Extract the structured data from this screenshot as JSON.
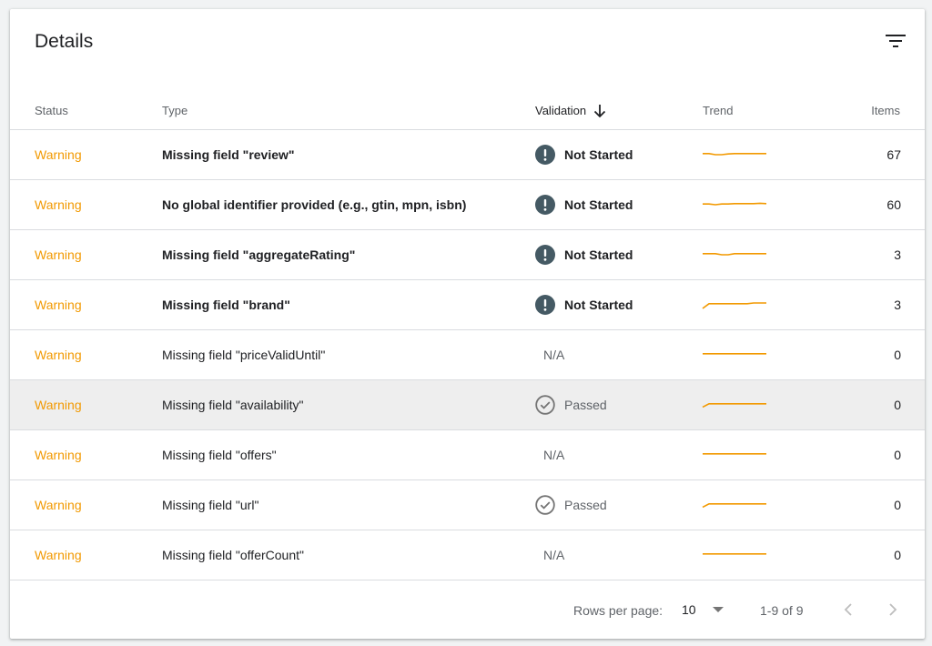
{
  "card": {
    "title": "Details",
    "filter_icon": "filter-list-icon"
  },
  "columns": {
    "status": "Status",
    "type": "Type",
    "validation": "Validation",
    "trend": "Trend",
    "items": "Items",
    "sort_icon": "arrow-down-icon"
  },
  "colors": {
    "warning": "#f29900",
    "trend_line": "#f29900",
    "not_started_icon": "#455a64",
    "passed_icon": "#757575",
    "highlight_row": "#eeeeee"
  },
  "rows": [
    {
      "status": "Warning",
      "type": "Missing field \"review\"",
      "bold": true,
      "validation": "Not Started",
      "validation_kind": "not_started",
      "items": "67",
      "trend": [
        0.3,
        0.3,
        0.0,
        0.0,
        0.2,
        0.3,
        0.3,
        0.3,
        0.3,
        0.3,
        0.3
      ]
    },
    {
      "status": "Warning",
      "type": "No global identifier provided (e.g., gtin, mpn, isbn)",
      "bold": true,
      "validation": "Not Started",
      "validation_kind": "not_started",
      "items": "60",
      "trend": [
        0.2,
        0.2,
        0.0,
        0.2,
        0.2,
        0.3,
        0.3,
        0.3,
        0.3,
        0.4,
        0.3
      ]
    },
    {
      "status": "Warning",
      "type": "Missing field \"aggregateRating\"",
      "bold": true,
      "validation": "Not Started",
      "validation_kind": "not_started",
      "items": "3",
      "trend": [
        0.3,
        0.3,
        0.3,
        0.0,
        0.0,
        0.3,
        0.3,
        0.3,
        0.3,
        0.3,
        0.3
      ]
    },
    {
      "status": "Warning",
      "type": "Missing field \"brand\"",
      "bold": true,
      "validation": "Not Started",
      "validation_kind": "not_started",
      "items": "3",
      "trend": [
        -1.0,
        0.3,
        0.3,
        0.3,
        0.3,
        0.3,
        0.3,
        0.3,
        0.5,
        0.5,
        0.5
      ]
    },
    {
      "status": "Warning",
      "type": "Missing field \"priceValidUntil\"",
      "bold": false,
      "validation": "N/A",
      "validation_kind": "na",
      "items": "0",
      "trend": [
        0.3,
        0.3,
        0.3,
        0.3,
        0.3,
        0.3,
        0.3,
        0.3,
        0.3,
        0.3,
        0.3
      ]
    },
    {
      "status": "Warning",
      "type": "Missing field \"availability\"",
      "bold": false,
      "validation": "Passed",
      "validation_kind": "passed",
      "items": "0",
      "trend": [
        -0.6,
        0.3,
        0.3,
        0.3,
        0.3,
        0.3,
        0.3,
        0.3,
        0.3,
        0.3,
        0.3
      ],
      "highlighted": true
    },
    {
      "status": "Warning",
      "type": "Missing field \"offers\"",
      "bold": false,
      "validation": "N/A",
      "validation_kind": "na",
      "items": "0",
      "trend": [
        0.3,
        0.3,
        0.3,
        0.3,
        0.3,
        0.3,
        0.3,
        0.3,
        0.3,
        0.3,
        0.3
      ]
    },
    {
      "status": "Warning",
      "type": "Missing field \"url\"",
      "bold": false,
      "validation": "Passed",
      "validation_kind": "passed",
      "items": "0",
      "trend": [
        -0.6,
        0.3,
        0.3,
        0.3,
        0.3,
        0.3,
        0.3,
        0.3,
        0.3,
        0.3,
        0.3
      ]
    },
    {
      "status": "Warning",
      "type": "Missing field \"offerCount\"",
      "bold": false,
      "validation": "N/A",
      "validation_kind": "na",
      "items": "0",
      "trend": [
        0.3,
        0.3,
        0.3,
        0.3,
        0.3,
        0.3,
        0.3,
        0.3,
        0.3,
        0.3,
        0.3
      ]
    }
  ],
  "footer": {
    "rows_per_page_label": "Rows per page:",
    "rows_per_page_value": "10",
    "range": "1-9 of 9",
    "prev_icon": "chevron-left-icon",
    "next_icon": "chevron-right-icon"
  }
}
